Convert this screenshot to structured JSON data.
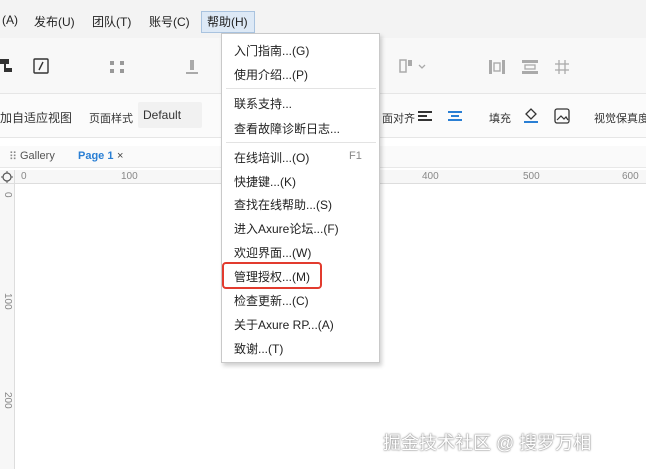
{
  "menubar": {
    "items": [
      {
        "label": "(A)"
      },
      {
        "label": "发布(U)"
      },
      {
        "label": "团队(T)"
      },
      {
        "label": "账号(C)"
      },
      {
        "label": "帮助(H)"
      }
    ]
  },
  "toolbar2": {
    "adaptive_view": "加自适应视图",
    "page_style": "页面样式",
    "style_value": "Default",
    "align": "面对齐",
    "fill": "填充",
    "fidelity": "视觉保真度"
  },
  "tabs": [
    {
      "label": "Gallery"
    },
    {
      "label": "Page 1"
    },
    {
      "label": "×"
    }
  ],
  "ruler": {
    "h": [
      "0",
      "100",
      "400",
      "500",
      "600"
    ],
    "v": [
      "0",
      "100",
      "200"
    ]
  },
  "help_menu": {
    "items": [
      {
        "label": "入门指南...(G)",
        "shortcut": ""
      },
      {
        "label": "使用介绍...(P)",
        "shortcut": ""
      },
      {
        "label": "联系支持...",
        "shortcut": ""
      },
      {
        "label": "查看故障诊断日志...",
        "shortcut": ""
      },
      {
        "label": "在线培训...(O)",
        "shortcut": "F1"
      },
      {
        "label": "快捷键...(K)",
        "shortcut": ""
      },
      {
        "label": "查找在线帮助...(S)",
        "shortcut": ""
      },
      {
        "label": "进入Axure论坛...(F)",
        "shortcut": ""
      },
      {
        "label": "欢迎界面...(W)",
        "shortcut": ""
      },
      {
        "label": "管理授权...(M)",
        "shortcut": ""
      },
      {
        "label": "检查更新...(C)",
        "shortcut": ""
      },
      {
        "label": "关于Axure RP...(A)",
        "shortcut": ""
      },
      {
        "label": "致谢...(T)",
        "shortcut": ""
      }
    ]
  },
  "watermark": "掘金技术社区 @ 搜罗万相",
  "colors": {
    "highlight": "#e23b2e",
    "accent": "#2a7fd4"
  }
}
